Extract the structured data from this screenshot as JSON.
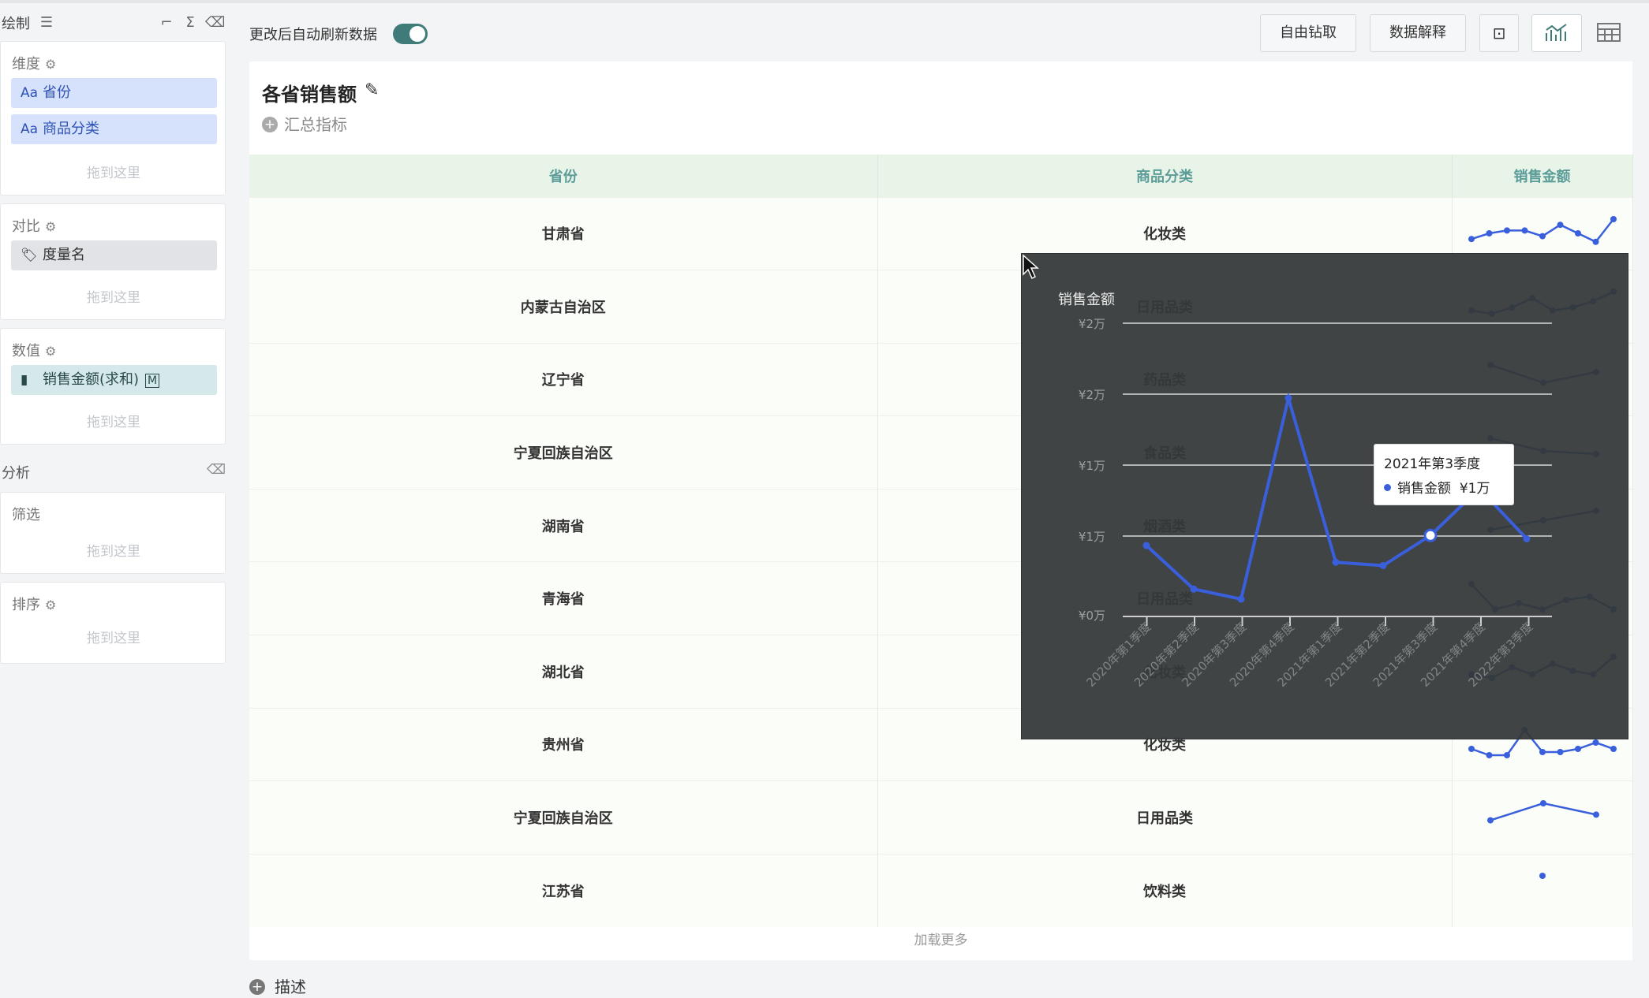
{
  "sidebar": {
    "title": "绘制",
    "dimension": {
      "title": "维度",
      "fields": [
        "省份",
        "商品分类"
      ],
      "field_icon": "Aa",
      "drop": "拖到这里"
    },
    "compare": {
      "title": "对比",
      "field": "度量名",
      "drop": "拖到这里"
    },
    "values": {
      "title": "数值",
      "field": "销售金额(求和)",
      "drop": "拖到这里"
    },
    "analysis": {
      "title": "分析"
    },
    "filter": {
      "title": "筛选",
      "drop": "拖到这里"
    },
    "sort": {
      "title": "排序",
      "drop": "拖到这里"
    }
  },
  "toolbar": {
    "auto_refresh_label": "更改后自动刷新数据",
    "auto_refresh_on": true,
    "drill_label": "自由钻取",
    "explain_label": "数据解释"
  },
  "card": {
    "title": "各省销售额",
    "summary_label": "汇总指标",
    "columns": [
      "省份",
      "商品分类",
      "销售金额"
    ],
    "rows": [
      {
        "province": "甘肃省",
        "category": "化妆类",
        "spark": [
          3,
          5,
          6,
          6,
          4,
          8,
          5,
          2,
          10
        ]
      },
      {
        "province": "内蒙古自治区",
        "category": "日用品类",
        "spark": [
          3,
          2,
          4,
          7,
          3,
          4,
          6,
          9
        ]
      },
      {
        "province": "辽宁省",
        "category": "药品类",
        "spark": [
          8,
          3,
          6
        ]
      },
      {
        "province": "宁夏回族自治区",
        "category": "食品类",
        "spark": [
          9,
          5,
          4
        ]
      },
      {
        "province": "湖南省",
        "category": "烟酒类",
        "spark": [
          2,
          4,
          6
        ]
      },
      {
        "province": "青海省",
        "category": "日用品类",
        "spark": [
          9,
          1,
          3,
          1,
          4,
          5,
          1
        ]
      },
      {
        "province": "湖北省",
        "category": "化妆类",
        "spark": [
          3,
          2,
          5,
          3,
          6,
          4,
          3,
          8
        ]
      },
      {
        "province": "贵州省",
        "category": "化妆类",
        "spark": [
          3,
          1,
          1,
          9,
          2,
          2,
          3,
          5,
          3
        ]
      },
      {
        "province": "宁夏回族自治区",
        "category": "日用品类",
        "spark": [
          2,
          5,
          3
        ]
      },
      {
        "province": "江苏省",
        "category": "饮料类",
        "spark": [
          5
        ]
      }
    ],
    "load_more": "加载更多"
  },
  "describe_label": "描述",
  "popup": {
    "ylabel": "销售金额",
    "y_tick_labels": [
      "¥0万",
      "¥1万",
      "¥1万",
      "¥2万",
      "¥2万"
    ],
    "tooltip_title": "2021年第3季度",
    "tooltip_series": "销售金额",
    "tooltip_value": "¥1万"
  },
  "chart_data": {
    "type": "line",
    "title": "",
    "ylabel": "销售金额",
    "x": [
      "2020年第1季度",
      "2020年第2季度",
      "2020年第3季度",
      "2020年第4季度",
      "2021年第1季度",
      "2021年第2季度",
      "2021年第3季度",
      "2021年第4季度",
      "2022年第3季度"
    ],
    "series": [
      {
        "name": "销售金额",
        "values": [
          10000,
          3500,
          2000,
          32000,
          7500,
          7000,
          11500,
          18500,
          11000
        ]
      }
    ],
    "ylim": [
      0,
      40000
    ],
    "grid": true,
    "highlight_index": 6,
    "color": "#3a5fdc"
  }
}
